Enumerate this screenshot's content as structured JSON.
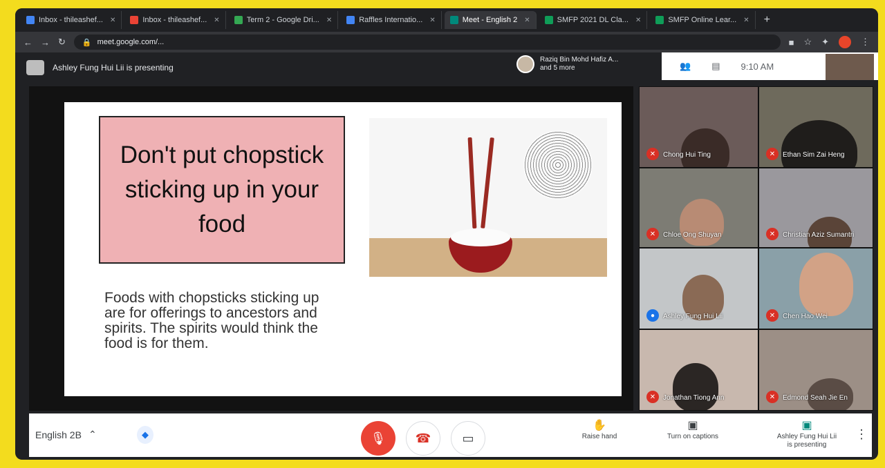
{
  "browser": {
    "tabs": [
      {
        "label": "Inbox - thileashef...",
        "color": "#4285f4"
      },
      {
        "label": "Inbox - thileashef...",
        "color": "#ea4335"
      },
      {
        "label": "Term 2 - Google Dri...",
        "color": "#34a853"
      },
      {
        "label": "Raffles Internatio...",
        "color": "#4285f4"
      },
      {
        "label": "Meet - English 2",
        "color": "#00897b",
        "active": true
      },
      {
        "label": "SMFP 2021 DL Cla...",
        "color": "#0f9d58"
      },
      {
        "label": "SMFP Online Lear...",
        "color": "#0f9d58"
      }
    ],
    "new_tab_symbol": "+",
    "url": "meet.google.com/..."
  },
  "meet_top": {
    "presenting_text": "Ashley Fung Hui Lii is presenting",
    "people_text_line1": "Raziq Bin Mohd Hafiz A...",
    "people_text_line2": "and 5 more",
    "time": "9:10 AM"
  },
  "slide": {
    "heading": "Don't put chopstick sticking up in your food",
    "note": "Foods with chopsticks sticking up are for offerings to ancestors and spirits. The spirits would think the food is for them."
  },
  "participants": [
    {
      "name": "Chong Hui Ting"
    },
    {
      "name": "Ethan Sim Zai Heng"
    },
    {
      "name": "Chloe Ong Shuyan"
    },
    {
      "name": "Christian Aziz Sumantri"
    },
    {
      "name": "Ashley Fung Hui Lii"
    },
    {
      "name": "Chen Hao Wei"
    },
    {
      "name": "Jonathan Tiong Ann"
    },
    {
      "name": "Edmond Seah Jie En"
    }
  ],
  "bottom_bar": {
    "meeting_name": "English 2B",
    "raise_hand": "Raise hand",
    "captions": "Turn on captions",
    "presenting_line1": "Ashley Fung Hui Lii",
    "presenting_line2": "is presenting"
  },
  "colors": {
    "mic_off": "#ea4335",
    "hangup": "#d93025",
    "background": "#f3dc1e"
  }
}
